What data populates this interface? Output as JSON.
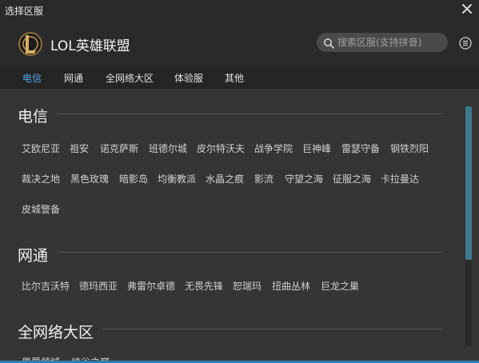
{
  "window": {
    "title": "选择区服"
  },
  "header": {
    "game_name": "LOL英雄联盟"
  },
  "search": {
    "placeholder": "搜索区服(支持拼音)"
  },
  "tabs": [
    {
      "label": "电信",
      "active": true
    },
    {
      "label": "网通",
      "active": false
    },
    {
      "label": "全网络大区",
      "active": false
    },
    {
      "label": "体验服",
      "active": false
    },
    {
      "label": "其他",
      "active": false
    }
  ],
  "sections": [
    {
      "title": "电信",
      "servers": [
        "艾欧尼亚",
        "祖安",
        "诺克萨斯",
        "班德尔城",
        "皮尔特沃夫",
        "战争学院",
        "巨神峰",
        "雷瑟守备",
        "钢铁烈阳",
        "裁决之地",
        "黑色玫瑰",
        "暗影岛",
        "均衡教派",
        "水晶之痕",
        "影流",
        "守望之海",
        "征服之海",
        "卡拉曼达",
        "皮城警备"
      ]
    },
    {
      "title": "网通",
      "servers": [
        "比尔吉沃特",
        "德玛西亚",
        "弗雷尔卓德",
        "无畏先锋",
        "恕瑞玛",
        "扭曲丛林",
        "巨龙之巢"
      ]
    },
    {
      "title": "全网络大区",
      "servers": [
        "男爵领域",
        "峡谷之巅"
      ]
    }
  ],
  "colors": {
    "accent": "#57a9e8",
    "scroll_thumb": "#3d7a8f",
    "panel": "#353535"
  },
  "icons": [
    "close-icon",
    "lol-logo",
    "search-icon",
    "menu-icon"
  ]
}
